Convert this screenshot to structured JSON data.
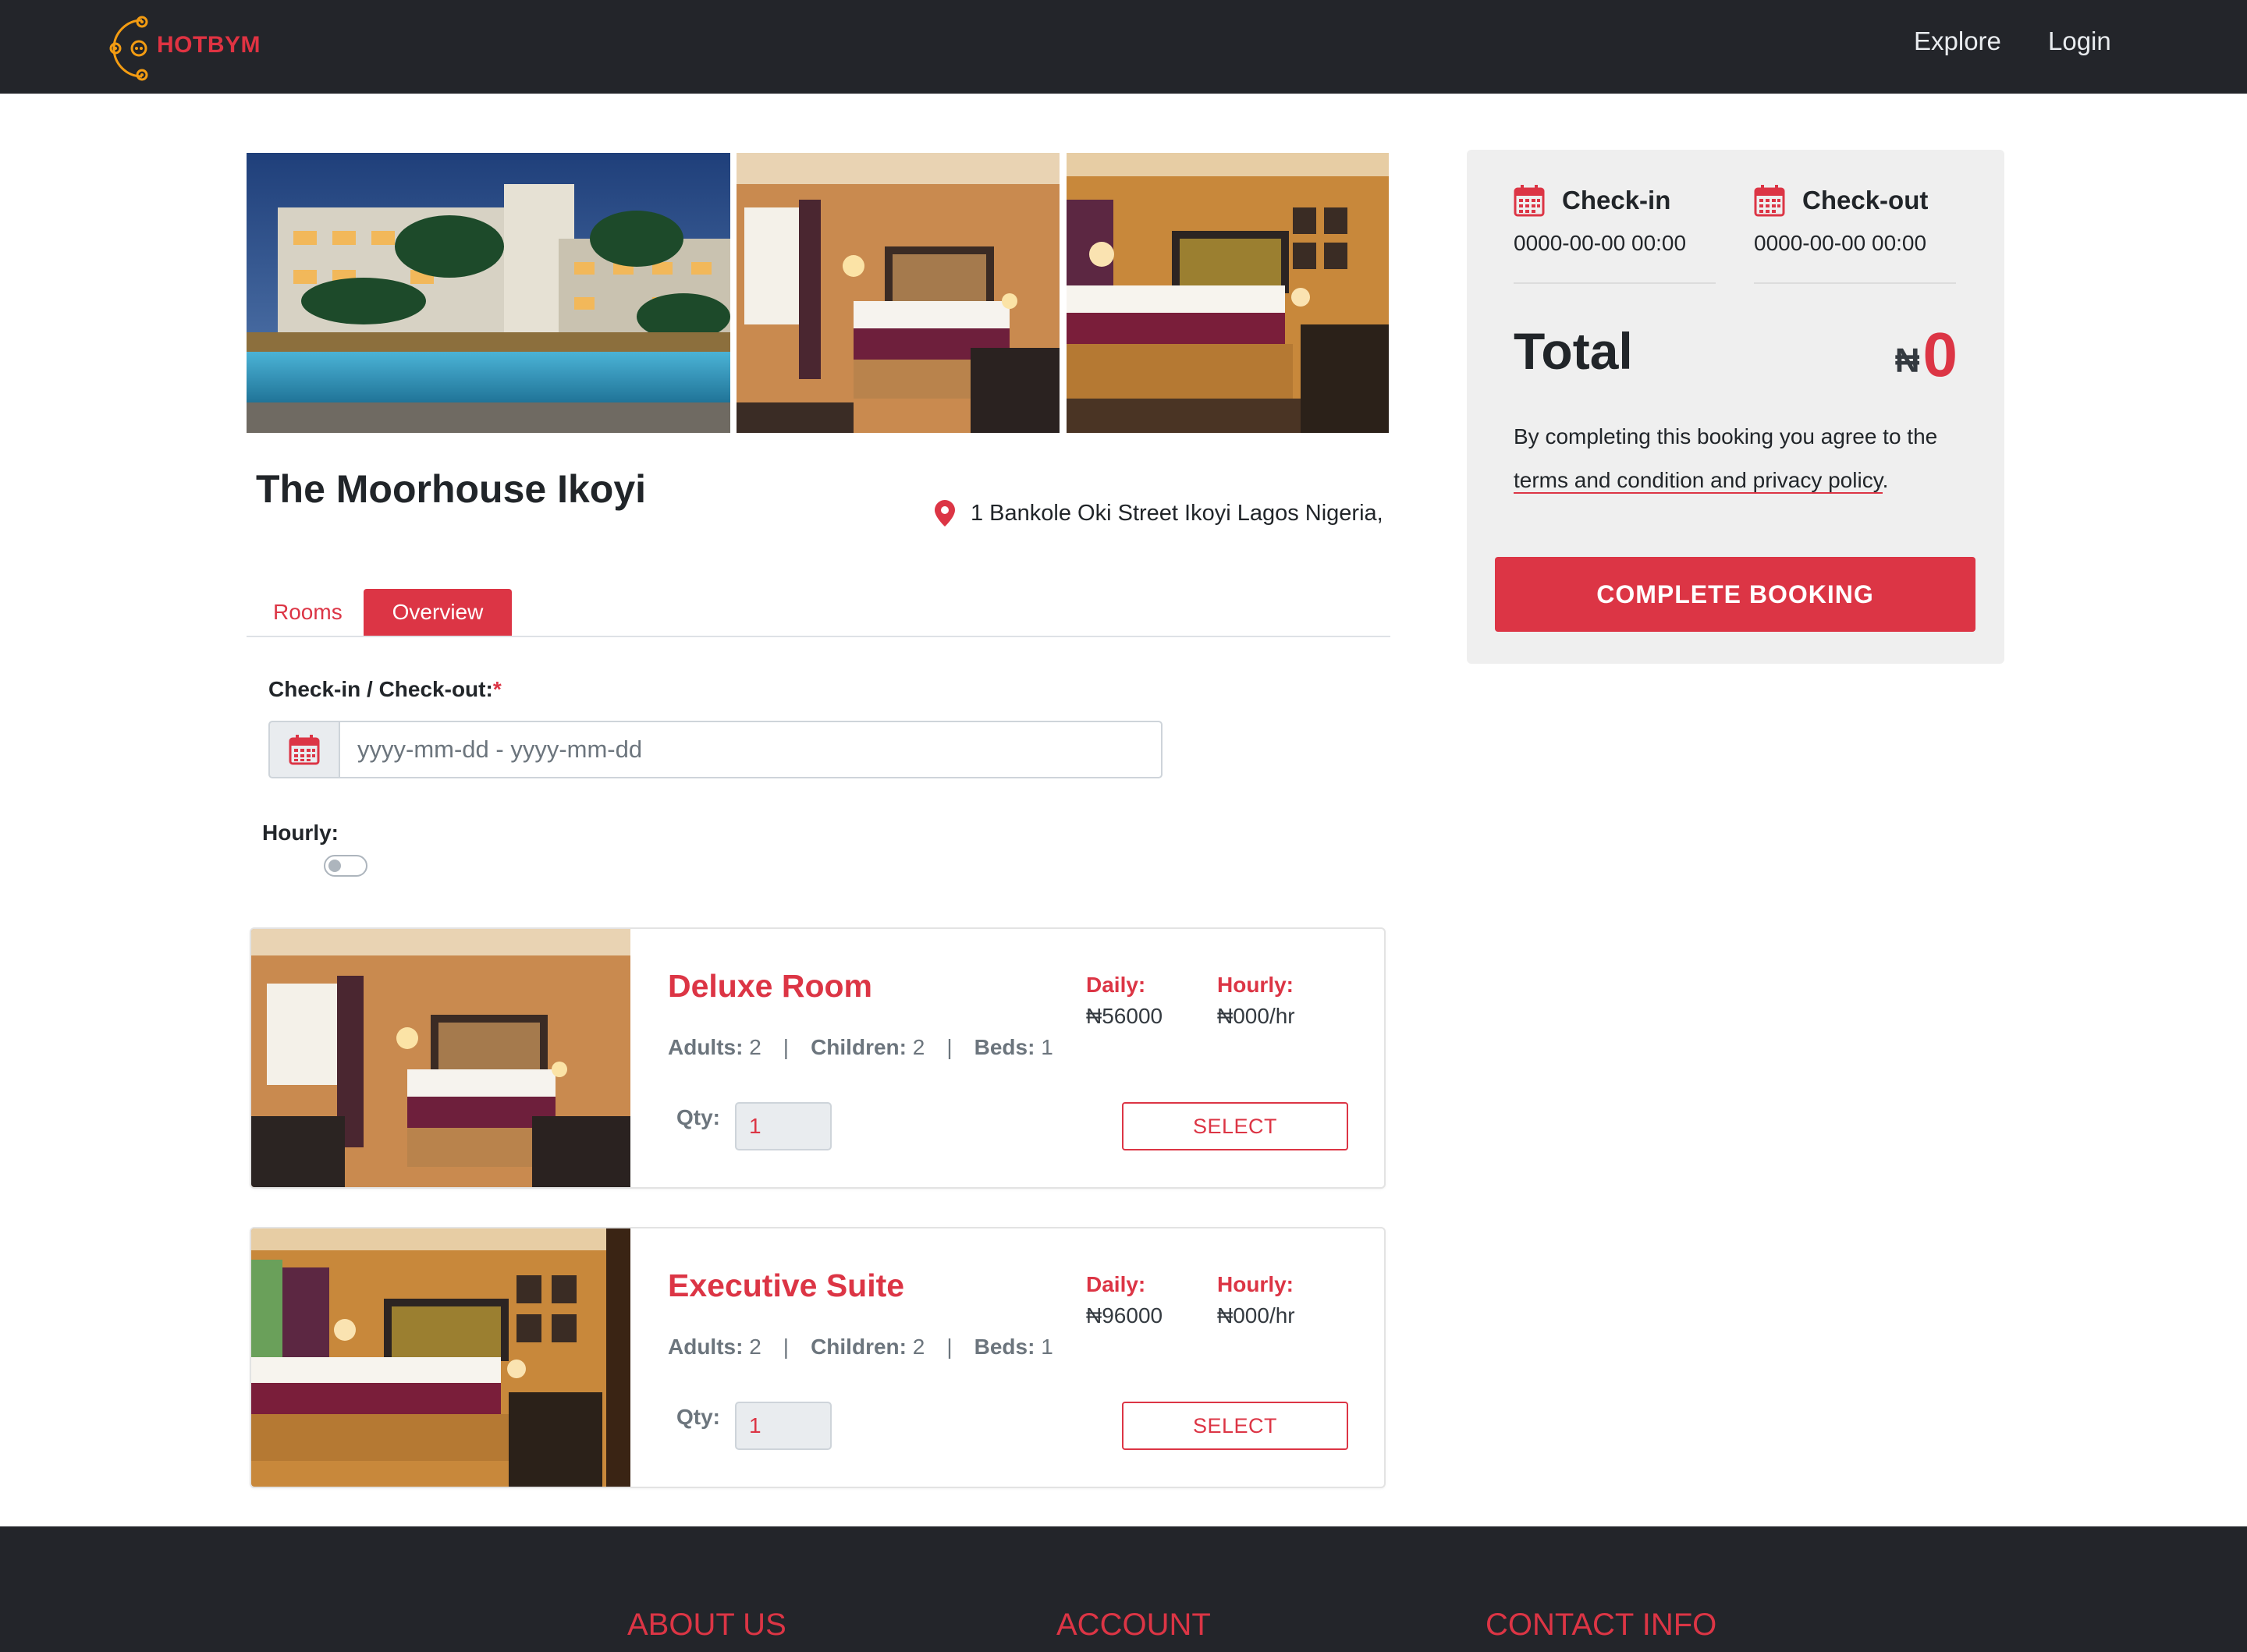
{
  "brand": {
    "name": "HOTBYM",
    "accent_color": "#dc3545",
    "header_bg": "#23252a"
  },
  "nav": {
    "explore": "Explore",
    "login": "Login"
  },
  "gallery": [
    {
      "icon": "hotel-pool-photo"
    },
    {
      "icon": "deluxe-bedroom-photo"
    },
    {
      "icon": "suite-bedroom-photo"
    }
  ],
  "hotel": {
    "name": "The Moorhouse Ikoyi",
    "address": "1 Bankole Oki Street Ikoyi Lagos Nigeria,"
  },
  "tabs": {
    "rooms": "Rooms",
    "overview": "Overview",
    "active": "Overview"
  },
  "form": {
    "dates_label": "Check-in / Check-out:",
    "required_mark": "*",
    "dates_placeholder": "yyyy-mm-dd - yyyy-mm-dd",
    "dates_value": "",
    "hourly_label": "Hourly:",
    "hourly_on": false
  },
  "rooms": [
    {
      "name": "Deluxe Room",
      "adults_label": "Adults:",
      "adults": "2",
      "children_label": "Children:",
      "children": "2",
      "beds_label": "Beds:",
      "beds": "1",
      "daily_label": "Daily:",
      "daily_price": "₦56000",
      "hourly_label": "Hourly:",
      "hourly_price": "₦000/hr",
      "qty_label": "Qty:",
      "qty": "1",
      "select_label": "SELECT"
    },
    {
      "name": "Executive Suite",
      "adults_label": "Adults:",
      "adults": "2",
      "children_label": "Children:",
      "children": "2",
      "beds_label": "Beds:",
      "beds": "1",
      "daily_label": "Daily:",
      "daily_price": "₦96000",
      "hourly_label": "Hourly:",
      "hourly_price": "₦000/hr",
      "qty_label": "Qty:",
      "qty": "1",
      "select_label": "SELECT"
    }
  ],
  "summary": {
    "checkin_label": "Check-in",
    "checkin_value": "0000-00-00 00:00",
    "checkout_label": "Check-out",
    "checkout_value": "0000-00-00 00:00",
    "total_label": "Total",
    "currency": "₦",
    "total_value": "0",
    "agree_text": "By completing this booking you agree to the",
    "terms_link": "terms and condition and privacy policy",
    "agree_end": ".",
    "complete_button": "COMPLETE BOOKING"
  },
  "footer": {
    "about": "ABOUT US",
    "account": "ACCOUNT",
    "contact": "CONTACT INFO"
  }
}
